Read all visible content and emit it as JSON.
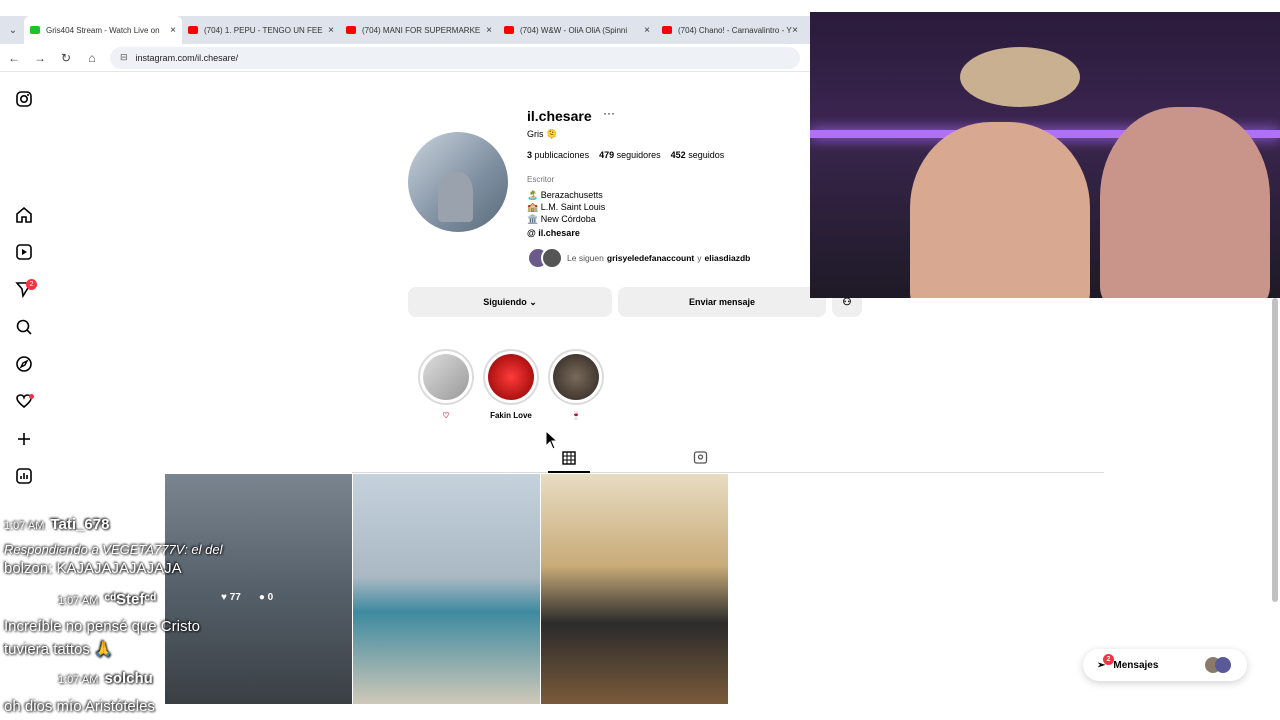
{
  "browser": {
    "tabs": [
      {
        "label": "Gris404 Stream - Watch Live on",
        "color": "#1ec51e"
      },
      {
        "label": "(704) 1. PEPU - TENGO UN FEE",
        "color": "#ff0000"
      },
      {
        "label": "(704) MANI FOR SUPERMARKE",
        "color": "#ff0000"
      },
      {
        "label": "(704) W&W - OliA OliA (Spinni",
        "color": "#ff0000"
      },
      {
        "label": "(704) Chano! - Carnavalintro - Y",
        "color": "#ff0000"
      }
    ],
    "tab_close": "×",
    "url": "instagram.com/il.chesare/"
  },
  "profile": {
    "username": "il.chesare",
    "more": "···",
    "full_name": "Gris 🫠",
    "posts": "3",
    "posts_label": "publicaciones",
    "followers": "479",
    "followers_label": "seguidores",
    "following": "452",
    "following_label": "seguidos",
    "category": "Escritor",
    "bio": [
      "🏝️ Berazachusetts",
      "🏫 L.M. Saint Louis",
      "🏛️ New Córdoba"
    ],
    "threads": "il.chesare",
    "followed_by_prefix": "Le siguen",
    "followed_by_1": "grisyeledefanaccount",
    "followed_by_sep": "y",
    "followed_by_2": "eliasdiazdb",
    "following_button": "Siguiendo",
    "message_button": "Enviar mensaje"
  },
  "highlights": [
    {
      "label": "♡"
    },
    {
      "label": "Fakin Love"
    },
    {
      "label": "🍷"
    }
  ],
  "grid_overlay": {
    "likes": "77",
    "comments": "0"
  },
  "messages_button": {
    "label": "Mensajes",
    "badge": "2"
  },
  "notifications_badge": "2",
  "chat": [
    {
      "time": "1:07 AM",
      "user": "Tati_678"
    },
    {
      "text": "Respondiendo a VEGETA777V: el del"
    },
    {
      "text": "bolzon:  KAJAJAJAJAJAJA"
    },
    {
      "time": "1:07 AM",
      "user": "ᶜᵈStefᶜᵈ"
    },
    {
      "text": "Increíble no pensé que Cristo"
    },
    {
      "text": "tuviera tattos 🙏"
    },
    {
      "time": "1:07 AM",
      "user": "solchu"
    },
    {
      "text": "oh dios mío Aristóteles"
    }
  ]
}
